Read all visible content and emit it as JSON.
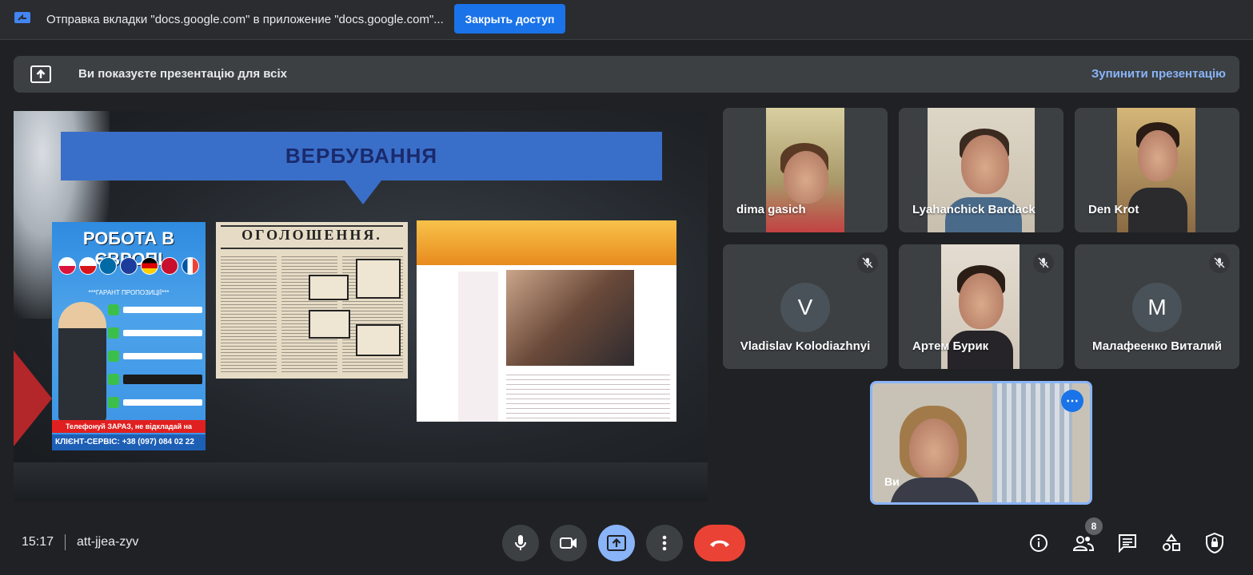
{
  "share_bar": {
    "message": "Отправка вкладки \"docs.google.com\" в приложение \"docs.google.com\"...",
    "stop_sharing_label": "Закрыть доступ"
  },
  "presentation_banner": {
    "message": "Ви показуєте презентацію для всіх",
    "stop_label": "Зупинити презентацію"
  },
  "slide": {
    "title": "ВЕРБУВАННЯ",
    "poster": {
      "heading": "РОБОТА В ЄВРОПІ",
      "guarantee": "***ГАРАНТ ПРОПОЗИЦІЇ***",
      "call_line": "Телефонуй ЗАРАЗ, не відкладай на завтра!",
      "client_line": "КЛІЄНТ-СЕРВІС: +38 (097) 084 02 22"
    },
    "newspaper": {
      "heading": "ОГОЛОШЕННЯ."
    }
  },
  "participants": [
    {
      "name": "dima gasich",
      "type": "video",
      "muted": false
    },
    {
      "name": "Lyahanchick Bardack",
      "type": "video",
      "muted": false
    },
    {
      "name": "Den Krot",
      "type": "video",
      "muted": false
    },
    {
      "name": "Vladislav Kolodiazhnyi",
      "type": "avatar",
      "initial": "V",
      "muted": true
    },
    {
      "name": "Артем Бурик",
      "type": "video",
      "muted": true
    },
    {
      "name": "Малафеенко Виталий",
      "type": "avatar",
      "initial": "M",
      "muted": true
    }
  ],
  "self_view": {
    "name": "Ви"
  },
  "bottom_bar": {
    "time": "15:17",
    "meeting_code": "att-jjea-zyv",
    "participant_count": "8",
    "controls": [
      "mic-icon",
      "camera-icon",
      "present-icon",
      "more-vert-icon",
      "hangup-icon"
    ],
    "right_controls": [
      "info-icon",
      "people-icon",
      "chat-icon",
      "activities-icon",
      "host-controls-icon"
    ]
  },
  "colors": {
    "accent_blue": "#1a73e8",
    "link_blue": "#8ab4f8",
    "hangup_red": "#ea4335",
    "background": "#202124",
    "tile": "#3c4043"
  }
}
